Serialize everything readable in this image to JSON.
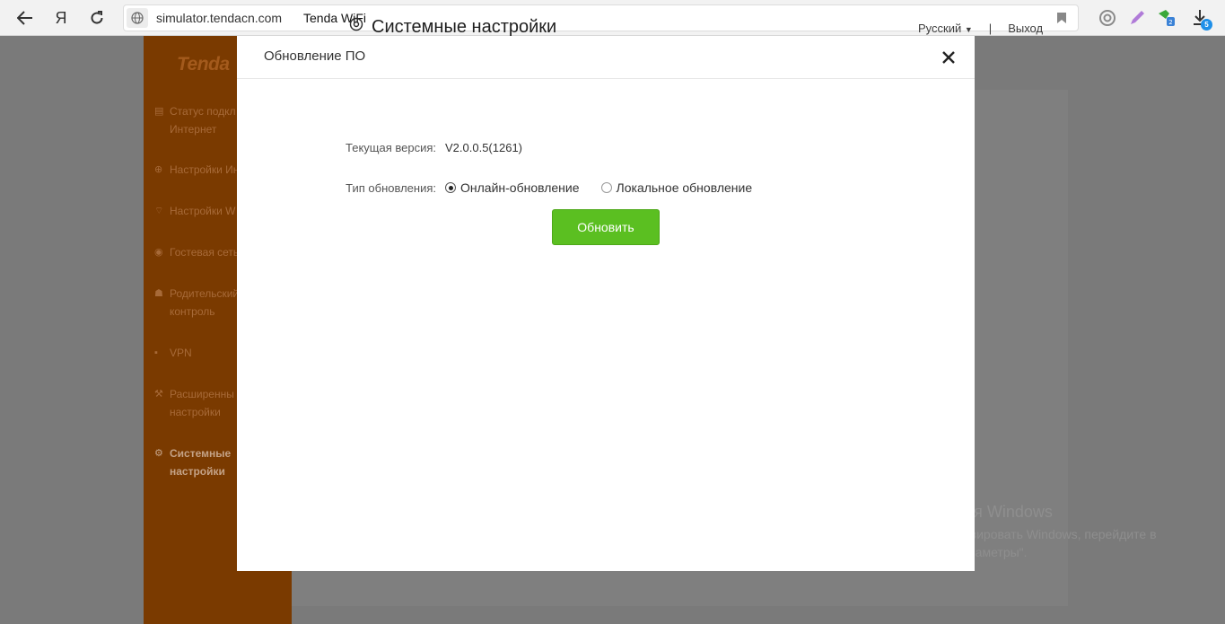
{
  "browser": {
    "url": "simulator.tendacn.com",
    "page_title": "Tenda WiFi",
    "yandex_label": "Я",
    "download_badge": "5"
  },
  "sidebar": {
    "logo": "Tenda",
    "items": [
      {
        "icon": "internet-status-icon",
        "label": "Статус подкл",
        "label2": "Интернет"
      },
      {
        "icon": "globe-icon",
        "label": "Настройки Ин"
      },
      {
        "icon": "wifi-icon",
        "label": "Настройки W"
      },
      {
        "icon": "guest-network-icon",
        "label": "Гостевая сеть"
      },
      {
        "icon": "parental-control-icon",
        "label": "Родительский",
        "label2": "контроль"
      },
      {
        "icon": "vpn-icon",
        "label": "VPN"
      },
      {
        "icon": "wrench-icon",
        "label": "Расширенны",
        "label2": "настройки"
      },
      {
        "icon": "gear-icon",
        "label": "Системные",
        "label2": "настройки",
        "active": true
      }
    ]
  },
  "main": {
    "title": "Системные настройки",
    "language": "Русский",
    "separator": "|",
    "logout": "Выход"
  },
  "modal": {
    "title": "Обновление ПО",
    "current_version_label": "Текущая версия:",
    "current_version_value": "V2.0.0.5(1261)",
    "update_type_label": "Тип обновления:",
    "options": [
      {
        "label": "Онлайн-обновление",
        "checked": true
      },
      {
        "label": "Локальное обновление",
        "checked": false
      }
    ],
    "update_button": "Обновить"
  },
  "watermark": {
    "line1": "Активация Windows",
    "line2": "Чтобы активировать Windows, перейдите в",
    "line3": "раздел \"Параметры\"."
  }
}
